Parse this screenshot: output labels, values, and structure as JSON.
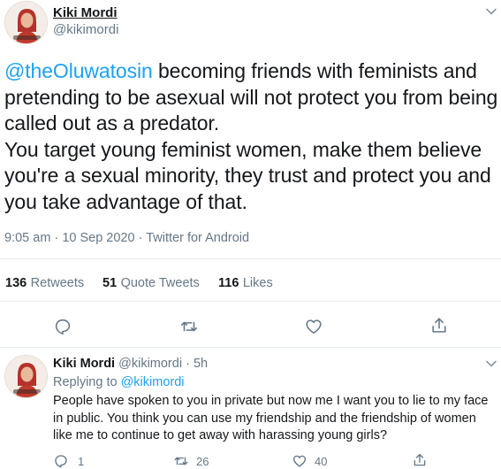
{
  "tweet": {
    "author_name": "Kiki Mordi",
    "author_handle": "@kikimordi",
    "mention": "@theOluwatosin",
    "text_after_mention": " becoming friends with feminists and pretending to be asexual will not protect you from being called out as a predator.",
    "text_para2": "You target young feminist women, make them believe you're a sexual minority, they trust and protect you and you take advantage of that.",
    "time": "9:05 am",
    "date": "10 Sep 2020",
    "source": "Twitter for Android",
    "dot": "·"
  },
  "stats": {
    "retweets_count": "136",
    "retweets_label": "Retweets",
    "quotes_count": "51",
    "quotes_label": "Quote Tweets",
    "likes_count": "116",
    "likes_label": "Likes"
  },
  "reply": {
    "author_name": "Kiki Mordi",
    "author_handle": "@kikimordi",
    "age": "5h",
    "dot": "·",
    "replying_prefix": "Replying to",
    "replying_to": "@kikimordi",
    "text": "People have spoken to you in private but now me I want you to lie to my face in public. You think you can use my friendship and the friendship of women like me to continue to get away with harassing young girls?",
    "reply_count": "1",
    "retweet_count": "26",
    "like_count": "40"
  },
  "colors": {
    "link": "#1da1f2",
    "muted": "#657786",
    "text": "#14171a",
    "divider": "#e6ecf0",
    "avatar_accent": "#c0392b"
  },
  "icons": [
    "chevron-down-icon",
    "reply-icon",
    "retweet-icon",
    "like-icon",
    "share-icon"
  ]
}
